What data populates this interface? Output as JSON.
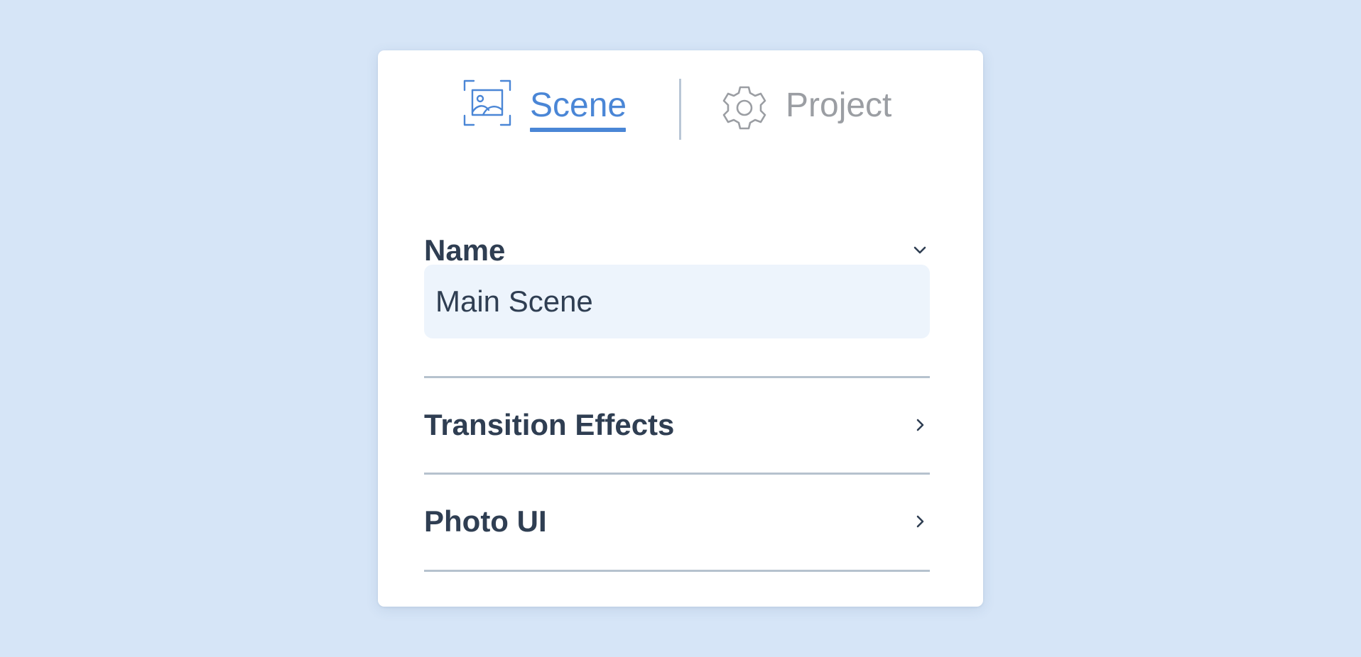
{
  "tabs": {
    "scene": {
      "label": "Scene",
      "icon": "scene-image-icon",
      "active": true,
      "color": "#4a86d6"
    },
    "project": {
      "label": "Project",
      "icon": "gear-icon",
      "active": false,
      "color": "#9b9ea3"
    }
  },
  "sections": {
    "name": {
      "title": "Name",
      "expanded": true,
      "chevron": "chevron-down-icon",
      "value": "Main Scene"
    },
    "transition_effects": {
      "title": "Transition Effects",
      "expanded": false,
      "chevron": "chevron-right-icon"
    },
    "photo_ui": {
      "title": "Photo UI",
      "expanded": false,
      "chevron": "chevron-right-icon"
    }
  },
  "colors": {
    "background": "#d6e5f7",
    "panel": "#ffffff",
    "accent": "#4a86d6",
    "text": "#2f3e52",
    "muted": "#9b9ea3",
    "input_bg": "#edf4fc",
    "divider": "#b6c2ce"
  }
}
